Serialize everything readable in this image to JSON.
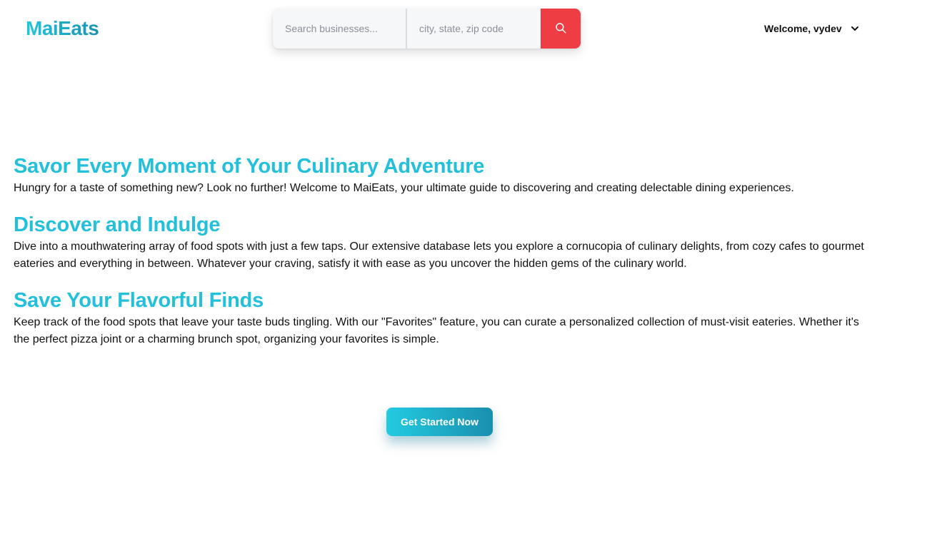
{
  "brand": {
    "logo_text": "MaiEats"
  },
  "search": {
    "business_placeholder": "Search businesses...",
    "location_placeholder": "city, state, zip code",
    "button_icon": "search-icon"
  },
  "user_menu": {
    "greeting": "Welcome, vydev",
    "icon": "chevron-down-icon"
  },
  "sections": [
    {
      "heading": "Savor Every Moment of Your Culinary Adventure",
      "body": "Hungry for a taste of something new? Look no further! Welcome to MaiEats, your ultimate guide to discovering and creating delectable dining experiences."
    },
    {
      "heading": "Discover and Indulge",
      "body": "Dive into a mouthwatering array of food spots with just a few taps. Our extensive database lets you explore a cornucopia of culinary delights, from cozy cafes to gourmet eateries and everything in between. Whatever your craving, satisfy it with ease as you uncover the hidden gems of the culinary world."
    },
    {
      "heading": "Save Your Flavorful Finds",
      "body": "Keep track of the food spots that leave your taste buds tingling. With our \"Favorites\" feature, you can curate a personalized collection of must-visit eateries. Whether it's the perfect pizza joint or a charming brunch spot, organizing your favorites is simple."
    }
  ],
  "cta": {
    "label": "Get Started Now"
  },
  "colors": {
    "brand_accent": "#22c0da",
    "search_button": "#ee3e43",
    "cta_gradient_start": "#22cbe2",
    "cta_gradient_end": "#1a8fae"
  }
}
